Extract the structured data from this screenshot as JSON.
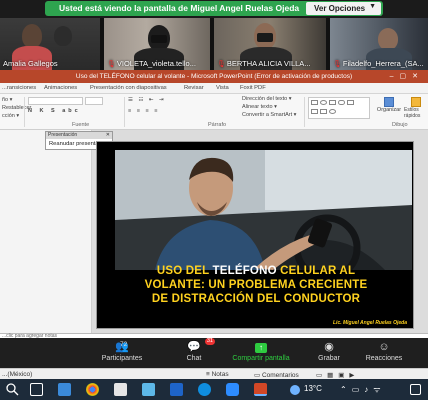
{
  "zoom": {
    "share_banner": "Usted está viendo la pantalla de Miguel Angel Ruelas Ojeda",
    "view_options": "Ver Opciones",
    "participants": [
      {
        "name": "Amalia Gallegos"
      },
      {
        "name": "VIOLETA_violeta.tello..."
      },
      {
        "name": "BERTHA ALICIA VILLA..."
      },
      {
        "name": "Filadelfo_Herrera_(SA..."
      }
    ],
    "controls": {
      "participants_label": "Participantes",
      "participants_count": "72",
      "chat_label": "Chat",
      "chat_badge": "31",
      "share_label": "Compartir pantalla",
      "record_label": "Grabar",
      "reactions_label": "Reacciones"
    }
  },
  "ppt": {
    "title": "Uso del TELÉFONO celular al volante - Microsoft PowerPoint (Error de activación de productos)",
    "tabs": [
      "...ransiciones",
      "Animaciones",
      "Presentación con diapositivas",
      "Revisar",
      "Vista",
      "Foxit PDF"
    ],
    "ribbon": {
      "left_items": [
        "ño ▾",
        "Restablecer",
        "cción ▾"
      ],
      "group_fuente": "Fuente",
      "group_parrafo": "Párrafo",
      "group_dibujo": "Dibujo",
      "right_items": [
        "Dirección del texto ▾",
        "Alinear texto ▾",
        "Convertir a SmartArt ▾"
      ],
      "organizar": "Organizar",
      "estilos": "Estilos rápidos"
    },
    "popup": {
      "title": "Presentación",
      "item": "Reanudar presentación"
    },
    "slide": {
      "headline_line1_a": "USO DEL ",
      "headline_line1_b": "TELÉFONO",
      "headline_line1_c": " CELULAR AL",
      "headline_line2": "VOLANTE: UN PROBLEMA CRECIENTE",
      "headline_line3": "DE DISTRACCIÓN DEL CONDUCTOR",
      "author": "Lic. Miguel Angel Ruelas Ojeda"
    },
    "notes_placeholder": "...clic para agregar notas",
    "status": {
      "language": "...(México)",
      "notes": "Notas",
      "comments": "Comentarios"
    }
  },
  "taskbar": {
    "temperature": "13°C"
  },
  "colors": {
    "zoom_green": "#2ea44f",
    "ppt_red": "#b7472a",
    "headline_yellow": "#ffd21f"
  }
}
